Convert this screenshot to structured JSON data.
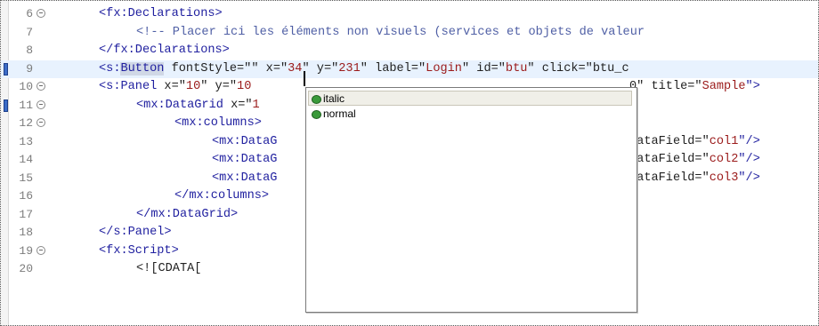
{
  "editor": {
    "lines": [
      {
        "num": "6",
        "fold": true,
        "bookmark": false,
        "current": false,
        "indent": 110,
        "segments": [
          {
            "t": "<fx:Declarations>",
            "c": "tag"
          }
        ]
      },
      {
        "num": "7",
        "fold": false,
        "bookmark": false,
        "current": false,
        "indent": 152,
        "segments": [
          {
            "t": "<!-- Placer ici les éléments non visuels (services et objets de valeur",
            "c": "comment"
          }
        ]
      },
      {
        "num": "8",
        "fold": false,
        "bookmark": false,
        "current": false,
        "indent": 110,
        "segments": [
          {
            "t": "</fx:Declarations>",
            "c": "tag"
          }
        ]
      },
      {
        "num": "9",
        "fold": false,
        "bookmark": true,
        "current": true,
        "indent": 110,
        "segments": [
          {
            "t": "<s:",
            "c": "tag"
          },
          {
            "t": "Button",
            "c": "tag sel"
          },
          {
            "t": " fontStyle=\"",
            "c": "attr"
          },
          {
            "t": "\" x=\"",
            "c": "attr"
          },
          {
            "t": "34",
            "c": "val"
          },
          {
            "t": "\" y=\"",
            "c": "attr"
          },
          {
            "t": "231",
            "c": "val"
          },
          {
            "t": "\" label=\"",
            "c": "attr"
          },
          {
            "t": "Login",
            "c": "val"
          },
          {
            "t": "\" id=\"",
            "c": "attr"
          },
          {
            "t": "btu",
            "c": "val"
          },
          {
            "t": "\" click=\"btu_c",
            "c": "attr"
          }
        ]
      },
      {
        "num": "10",
        "fold": true,
        "bookmark": false,
        "current": false,
        "indent": 110,
        "segments": [
          {
            "t": "<s:Panel",
            "c": "tag"
          },
          {
            "t": " x=\"",
            "c": "attr"
          },
          {
            "t": "10",
            "c": "val"
          },
          {
            "t": "\" y=\"",
            "c": "attr"
          },
          {
            "t": "10",
            "c": "val"
          }
        ],
        "tail": [
          {
            "t": "0\" title=\"",
            "c": "attr"
          },
          {
            "t": "Sample",
            "c": "val"
          },
          {
            "t": "\">",
            "c": "tag"
          }
        ]
      },
      {
        "num": "11",
        "fold": true,
        "bookmark": true,
        "current": false,
        "indent": 152,
        "segments": [
          {
            "t": "<mx:DataGrid",
            "c": "tag"
          },
          {
            "t": " x=\"",
            "c": "attr"
          },
          {
            "t": "1",
            "c": "val"
          }
        ]
      },
      {
        "num": "12",
        "fold": true,
        "bookmark": false,
        "current": false,
        "indent": 195,
        "segments": [
          {
            "t": "<mx:columns>",
            "c": "tag"
          }
        ]
      },
      {
        "num": "13",
        "fold": false,
        "bookmark": false,
        "current": false,
        "indent": 237,
        "segments": [
          {
            "t": "<mx:DataG",
            "c": "tag"
          }
        ],
        "tail": [
          {
            "t": "dataField=\"",
            "c": "attr"
          },
          {
            "t": "col1",
            "c": "val"
          },
          {
            "t": "\"/>",
            "c": "tag"
          }
        ]
      },
      {
        "num": "14",
        "fold": false,
        "bookmark": false,
        "current": false,
        "indent": 237,
        "segments": [
          {
            "t": "<mx:DataG",
            "c": "tag"
          }
        ],
        "tail": [
          {
            "t": "dataField=\"",
            "c": "attr"
          },
          {
            "t": "col2",
            "c": "val"
          },
          {
            "t": "\"/>",
            "c": "tag"
          }
        ]
      },
      {
        "num": "15",
        "fold": false,
        "bookmark": false,
        "current": false,
        "indent": 237,
        "segments": [
          {
            "t": "<mx:DataG",
            "c": "tag"
          }
        ],
        "tail": [
          {
            "t": "dataField=\"",
            "c": "attr"
          },
          {
            "t": "col3",
            "c": "val"
          },
          {
            "t": "\"/>",
            "c": "tag"
          }
        ]
      },
      {
        "num": "16",
        "fold": false,
        "bookmark": false,
        "current": false,
        "indent": 195,
        "segments": [
          {
            "t": "</mx:columns>",
            "c": "tag"
          }
        ]
      },
      {
        "num": "17",
        "fold": false,
        "bookmark": false,
        "current": false,
        "indent": 152,
        "segments": [
          {
            "t": "</mx:DataGrid>",
            "c": "tag"
          }
        ]
      },
      {
        "num": "18",
        "fold": false,
        "bookmark": false,
        "current": false,
        "indent": 110,
        "segments": [
          {
            "t": "</s:Panel>",
            "c": "tag"
          }
        ]
      },
      {
        "num": "19",
        "fold": true,
        "bookmark": false,
        "current": false,
        "indent": 110,
        "segments": [
          {
            "t": "<fx:Script>",
            "c": "tag"
          }
        ]
      },
      {
        "num": "20",
        "fold": false,
        "bookmark": false,
        "current": false,
        "indent": 152,
        "segments": [
          {
            "t": "<![CDATA[",
            "c": "attr"
          }
        ]
      }
    ]
  },
  "autocomplete": {
    "items": [
      {
        "label": "italic",
        "selected": true,
        "icon": "property-icon"
      },
      {
        "label": "normal",
        "selected": false,
        "icon": "property-icon"
      }
    ]
  },
  "colors": {
    "tag": "#1f1f9f",
    "value": "#9b1b1b",
    "comment": "#4f5fa5",
    "current_line": "#e8f2fe",
    "bookmark": "#3b6cc7"
  }
}
